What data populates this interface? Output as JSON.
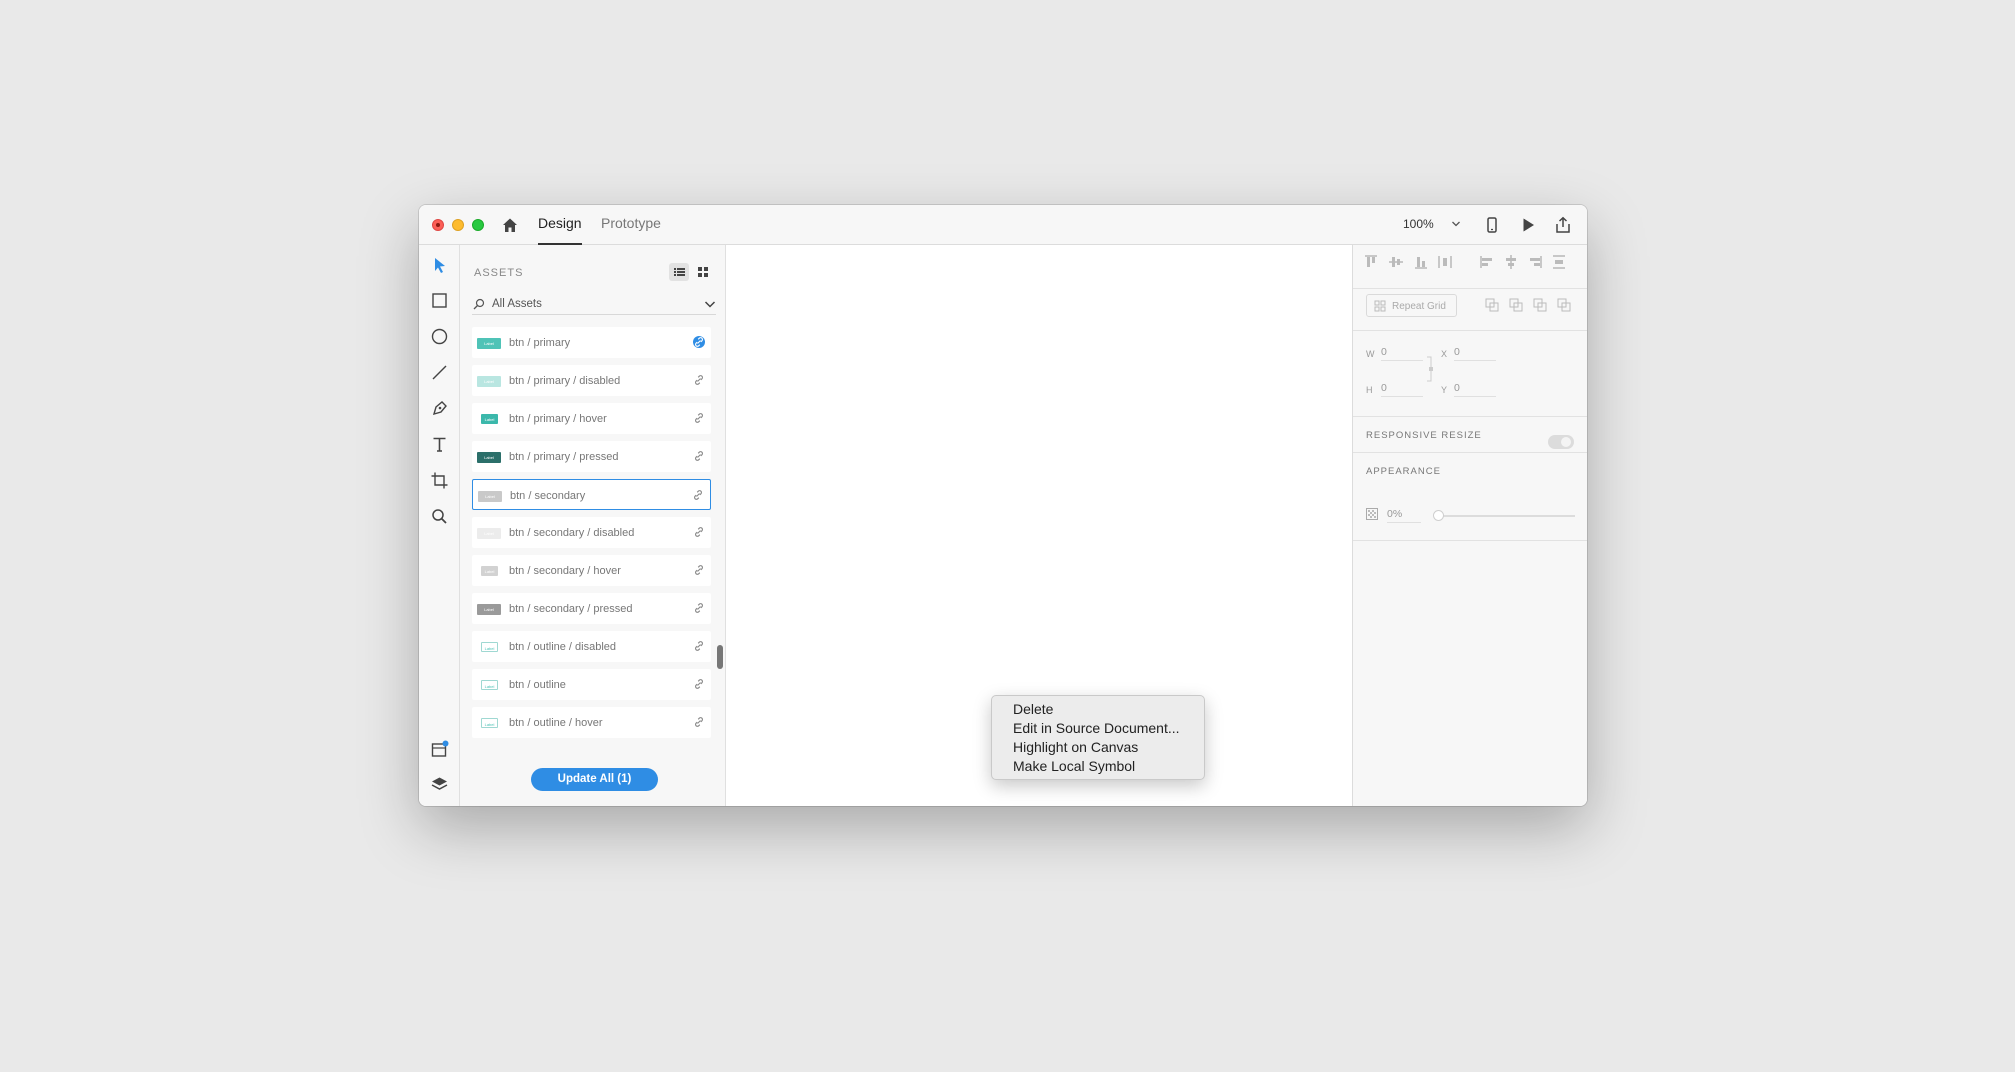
{
  "titlebar": {
    "tabs": [
      {
        "label": "Design",
        "active": true
      },
      {
        "label": "Prototype",
        "active": false
      }
    ],
    "zoom": "100%",
    "icons": [
      "home-icon",
      "chevron-down-icon",
      "device-preview-icon",
      "play-icon",
      "share-icon"
    ]
  },
  "tools": [
    "select-icon",
    "rectangle-icon",
    "ellipse-icon",
    "line-icon",
    "pen-icon",
    "text-icon",
    "artboard-icon",
    "zoom-icon",
    "assets-icon",
    "layers-icon"
  ],
  "assets": {
    "title": "ASSETS",
    "filter": "All Assets",
    "items": [
      {
        "name": "btn / primary",
        "thumb_color": "#4fc3b7",
        "thumb_label": "Label",
        "linked_active": true
      },
      {
        "name": "btn / primary / disabled",
        "thumb_color": "#b9e6e1",
        "thumb_label": "Label",
        "linked_active": false
      },
      {
        "name": "btn / primary / hover",
        "thumb_color": "#3bb8ab",
        "thumb_label": "Label",
        "linked_active": false
      },
      {
        "name": "btn / primary / pressed",
        "thumb_color": "#2b6f6a",
        "thumb_label": "Label",
        "linked_active": false
      },
      {
        "name": "btn / secondary",
        "thumb_color": "#c9c9c9",
        "thumb_label": "Label",
        "linked_active": false,
        "selected": true
      },
      {
        "name": "btn / secondary / disabled",
        "thumb_color": "#ececec",
        "thumb_label": "Label",
        "linked_active": false
      },
      {
        "name": "btn / secondary / hover",
        "thumb_color": "#d2d2d2",
        "thumb_label": "Label",
        "linked_active": false
      },
      {
        "name": "btn / secondary / pressed",
        "thumb_color": "#9a9a9a",
        "thumb_label": "Label",
        "linked_active": false
      },
      {
        "name": "btn / outline / disabled",
        "thumb_color": "#ffffff",
        "thumb_label": "Label",
        "linked_active": false,
        "outline": true
      },
      {
        "name": "btn / outline",
        "thumb_color": "#ffffff",
        "thumb_label": "Label",
        "linked_active": false,
        "outline": true
      },
      {
        "name": "btn / outline / hover",
        "thumb_color": "#e9f7f5",
        "thumb_label": "Label",
        "linked_active": false,
        "outline": true
      }
    ],
    "update_button": "Update All (1)"
  },
  "context_menu": {
    "items": [
      "Delete",
      "Edit in Source Document...",
      "Highlight on Canvas",
      "Make Local Symbol"
    ]
  },
  "inspector": {
    "repeat_grid": "Repeat Grid",
    "fields": [
      {
        "label": "W",
        "value": "0"
      },
      {
        "label": "X",
        "value": "0"
      },
      {
        "label": "H",
        "value": "0"
      },
      {
        "label": "Y",
        "value": "0"
      }
    ],
    "responsive_resize": "RESPONSIVE RESIZE",
    "appearance": "APPEARANCE",
    "opacity": "0%"
  },
  "colors": {
    "accent": "#2f8de4",
    "primary_btn": "#4fc3b7"
  }
}
